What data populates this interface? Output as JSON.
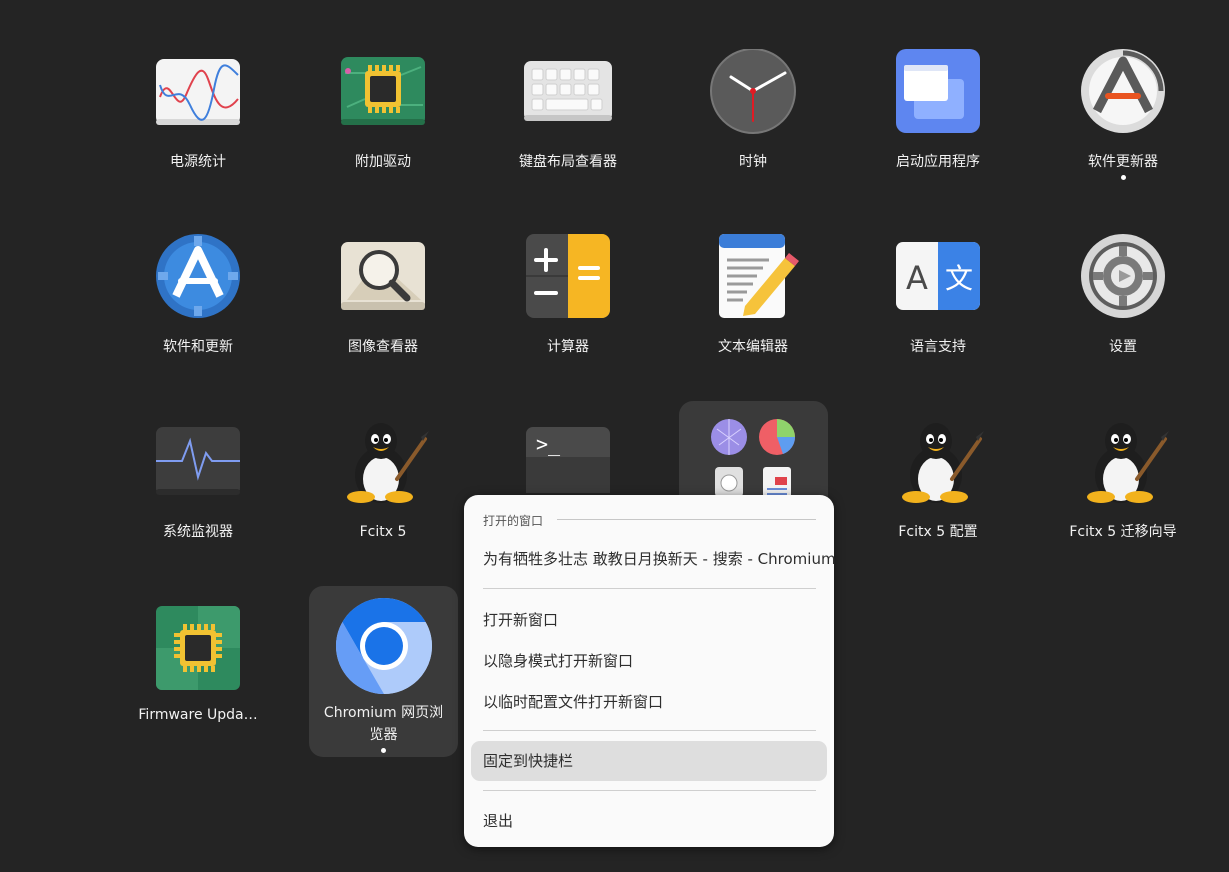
{
  "apps": {
    "power_stats": "电源统计",
    "additional_drivers": "附加驱动",
    "keyboard_viewer": "键盘布局查看器",
    "clock": "时钟",
    "startup_apps": "启动应用程序",
    "software_updater": "软件更新器",
    "software_updates": "软件和更新",
    "image_viewer": "图像查看器",
    "calculator": "计算器",
    "text_editor": "文本编辑器",
    "language_support": "语言支持",
    "settings": "设置",
    "system_monitor": "系统监视器",
    "fcitx5": "Fcitx 5",
    "fcitx5_config": "Fcitx 5 配置",
    "fcitx5_migrator": "Fcitx 5 迁移向导",
    "firmware_updater": "Firmware Upda…",
    "chromium": "Chromium 网页浏览器"
  },
  "context_menu": {
    "open_windows_title": "打开的窗口",
    "window_1": "为有牺牲多壮志 敢教日月换新天 - 搜索 - Chromium",
    "new_window": "打开新窗口",
    "new_incognito_window": "以隐身模式打开新窗口",
    "new_temp_profile_window": "以临时配置文件打开新窗口",
    "pin_to_dash": "固定到快捷栏",
    "quit": "退出"
  },
  "icons": {
    "terminal_prompt": ">_"
  },
  "colors": {
    "background": "#242424",
    "menu_bg": "#fafafa",
    "menu_hover": "#dedede",
    "clock_hand": "#e01b24",
    "calc_yellow": "#f6b623",
    "chromium_blue": "#1a73e8"
  }
}
